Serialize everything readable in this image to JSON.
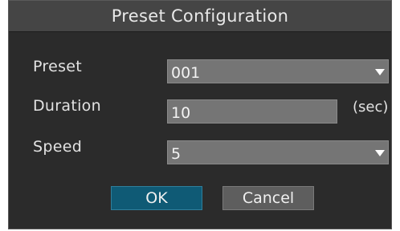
{
  "dialog": {
    "title": "Preset Configuration"
  },
  "form": {
    "preset_label": "Preset",
    "preset_value": "001",
    "duration_label": "Duration",
    "duration_value": "10",
    "duration_unit": "(sec)",
    "speed_label": "Speed",
    "speed_value": "5"
  },
  "buttons": {
    "ok_label": "OK",
    "cancel_label": "Cancel"
  },
  "colors": {
    "dialog_bg": "#2b2b2b",
    "titlebar_bg": "#454545",
    "field_bg": "#757575",
    "ok_button_bg": "#0f5a75",
    "cancel_button_bg": "#5e5e5e"
  },
  "icons": {
    "dropdown": "chevron-down-icon"
  }
}
